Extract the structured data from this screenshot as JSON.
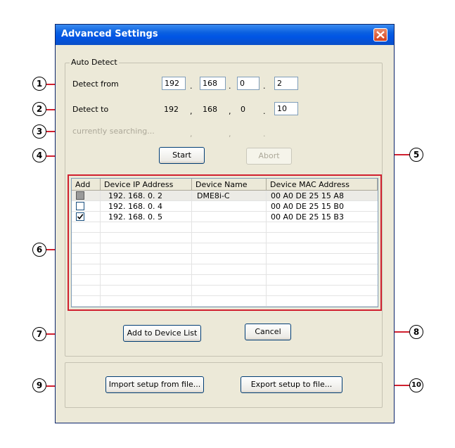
{
  "window": {
    "title": "Advanced Settings"
  },
  "auto_detect": {
    "legend": "Auto Detect",
    "detect_from_label": "Detect from",
    "detect_from": [
      "192",
      "168",
      "0",
      "2"
    ],
    "detect_to_label": "Detect to",
    "detect_to": [
      "192",
      "168",
      "0",
      "10"
    ],
    "searching_label": "currently searching...",
    "start_label": "Start",
    "abort_label": "Abort"
  },
  "list": {
    "columns": [
      "Add",
      "Device IP Address",
      "Device Name",
      "Device MAC Address"
    ],
    "rows": [
      {
        "state": "indeterminate",
        "ip": "192. 168.  0.  2",
        "name": "DME8i-C",
        "mac": "00 A0 DE 25 15 A8"
      },
      {
        "state": "unchecked",
        "ip": "192. 168.  0.  4",
        "name": "",
        "mac": "00 A0 DE 25 15 B0"
      },
      {
        "state": "checked",
        "ip": "192. 168.  0.  5",
        "name": "",
        "mac": "00 A0 DE 25 15 B3"
      }
    ]
  },
  "buttons": {
    "add_to_device_list": "Add to Device List",
    "cancel": "Cancel",
    "import": "Import setup from file...",
    "export": "Export setup to file..."
  },
  "callouts": [
    "1",
    "2",
    "3",
    "4",
    "5",
    "6",
    "7",
    "8",
    "9",
    "10"
  ],
  "colors": {
    "callout_line": "#d0202f",
    "title_bar": "#0055e5"
  }
}
